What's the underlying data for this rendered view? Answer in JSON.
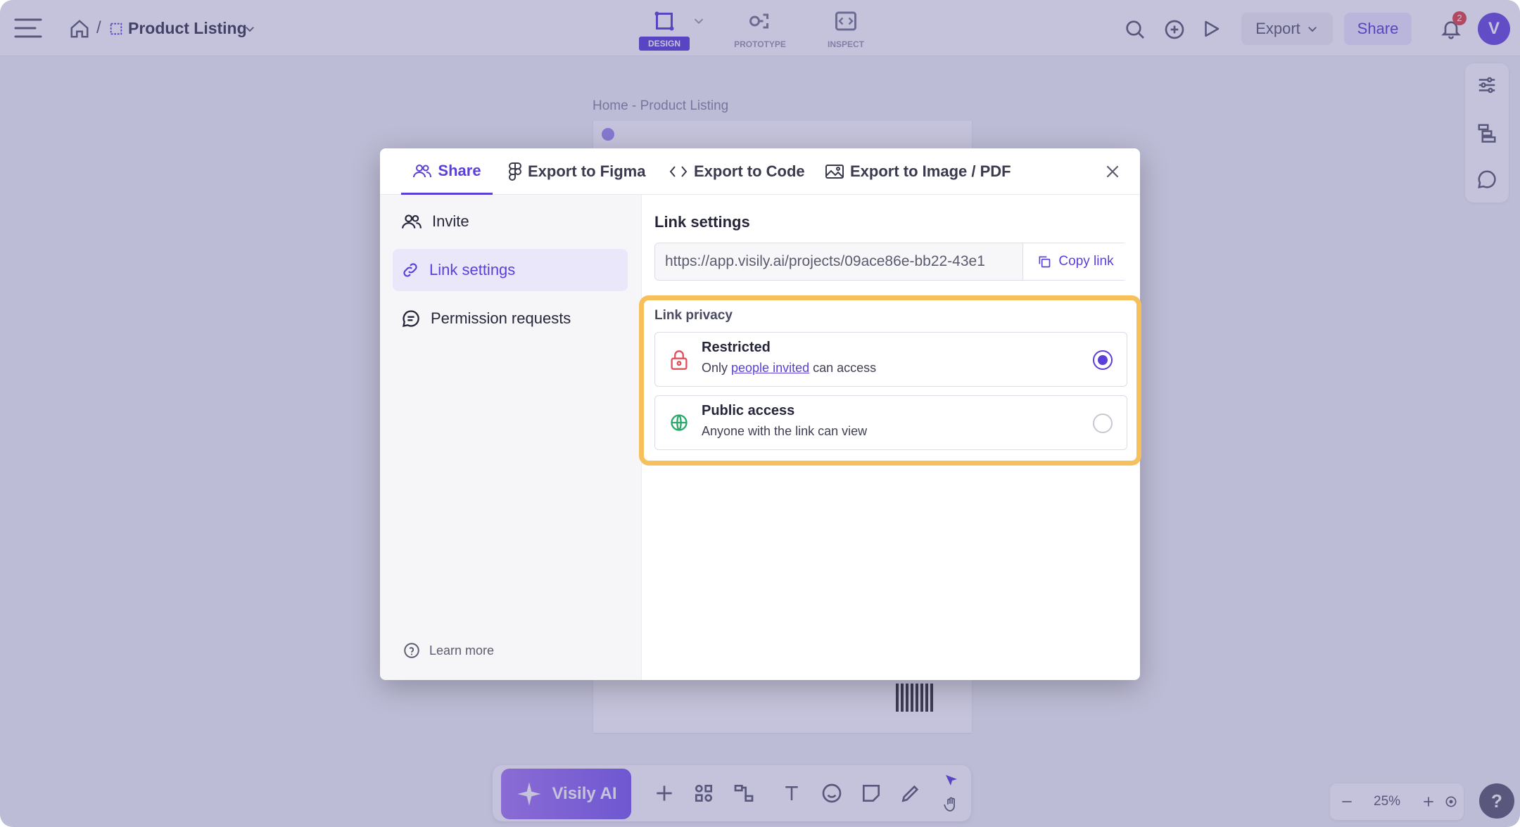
{
  "topbar": {
    "breadcrumb_separator": "/",
    "project_title": "Product Listing",
    "modes": [
      {
        "label": "DESIGN",
        "active": true
      },
      {
        "label": "PROTOTYPE",
        "active": false
      },
      {
        "label": "INSPECT",
        "active": false
      }
    ],
    "export_label": "Export",
    "share_label": "Share",
    "notification_count": "2",
    "avatar_letter": "V"
  },
  "canvas": {
    "frame_label": "Home - Product Listing"
  },
  "toolbar": {
    "ai_label": "Visily AI",
    "zoom_level": "25%"
  },
  "modal": {
    "tabs": [
      {
        "label": "Share",
        "icon": "users-icon",
        "active": true
      },
      {
        "label": "Export to Figma",
        "icon": "figma-icon",
        "active": false
      },
      {
        "label": "Export to Code",
        "icon": "code-icon",
        "active": false
      },
      {
        "label": "Export to Image / PDF",
        "icon": "image-icon",
        "active": false
      }
    ],
    "side_nav": [
      {
        "label": "Invite",
        "icon": "users-icon",
        "active": false
      },
      {
        "label": "Link settings",
        "icon": "link-icon",
        "active": true
      },
      {
        "label": "Permission requests",
        "icon": "message-icon",
        "active": false
      }
    ],
    "learn_more": "Learn more",
    "link_settings": {
      "heading": "Link settings",
      "url": "https://app.visily.ai/projects/09ace86e-bb22-43e1",
      "copy_label": "Copy link"
    },
    "privacy": {
      "label": "Link privacy",
      "options": [
        {
          "title": "Restricted",
          "desc_before": "Only ",
          "desc_link": "people invited",
          "desc_after": " can access",
          "selected": true,
          "icon": "lock-icon",
          "icon_color": "#e0505a"
        },
        {
          "title": "Public access",
          "desc": "Anyone with the link can view",
          "selected": false,
          "icon": "globe-icon",
          "icon_color": "#2aa86a"
        }
      ]
    }
  },
  "colors": {
    "accent": "#5b3fd8",
    "highlight": "#f6c15c"
  }
}
